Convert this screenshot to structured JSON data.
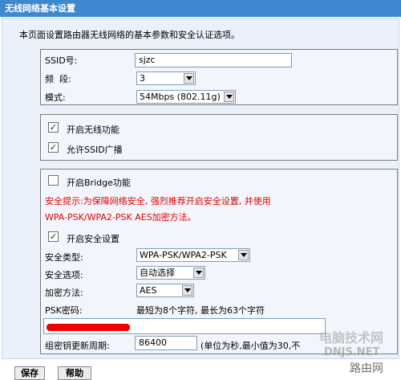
{
  "header": {
    "title": "无线网络基本设置"
  },
  "intro": "本页面设置路由器无线网络的基本参数和安全认证选项。",
  "basic": {
    "ssid_label": "SSID号:",
    "ssid_value": "sjzc",
    "channel_label": "频  段:",
    "channel_value": "3",
    "mode_label": "模式:",
    "mode_value": "54Mbps (802.11g)"
  },
  "wireless": {
    "enable_label": "开启无线功能",
    "enable_checked": true,
    "ssid_broadcast_label": "允许SSID广播",
    "ssid_broadcast_checked": true
  },
  "security": {
    "bridge_label": "开启Bridge功能",
    "bridge_checked": false,
    "warning_line1": "安全提示:为保障网络安全, 强烈推荐开启安全设置, 并使用",
    "warning_line2": "WPA-PSK/WPA2-PSK AES加密方法。",
    "enable_security_label": "开启安全设置",
    "enable_security_checked": true,
    "type_label": "安全类型:",
    "type_value": "WPA-PSK/WPA2-PSK",
    "option_label": "安全选项:",
    "option_value": "自动选择",
    "encryption_label": "加密方法:",
    "encryption_value": "AES",
    "psk_label": "PSK密码:",
    "psk_hint": "最短为8个字符, 最长为63个字符",
    "rekey_label": "组密钥更新周期:",
    "rekey_value": "86400",
    "rekey_hint": "(单位为秒,最小值为30,不"
  },
  "buttons": {
    "save": "保存",
    "help": "帮助"
  },
  "watermark": {
    "line1": "电脑技术网",
    "line2": "DNJS.NET",
    "line3": "路由网"
  },
  "colors": {
    "title_bg": "#3d88ce",
    "panel_bg": "#eaf1fb",
    "warning": "#e00000"
  }
}
